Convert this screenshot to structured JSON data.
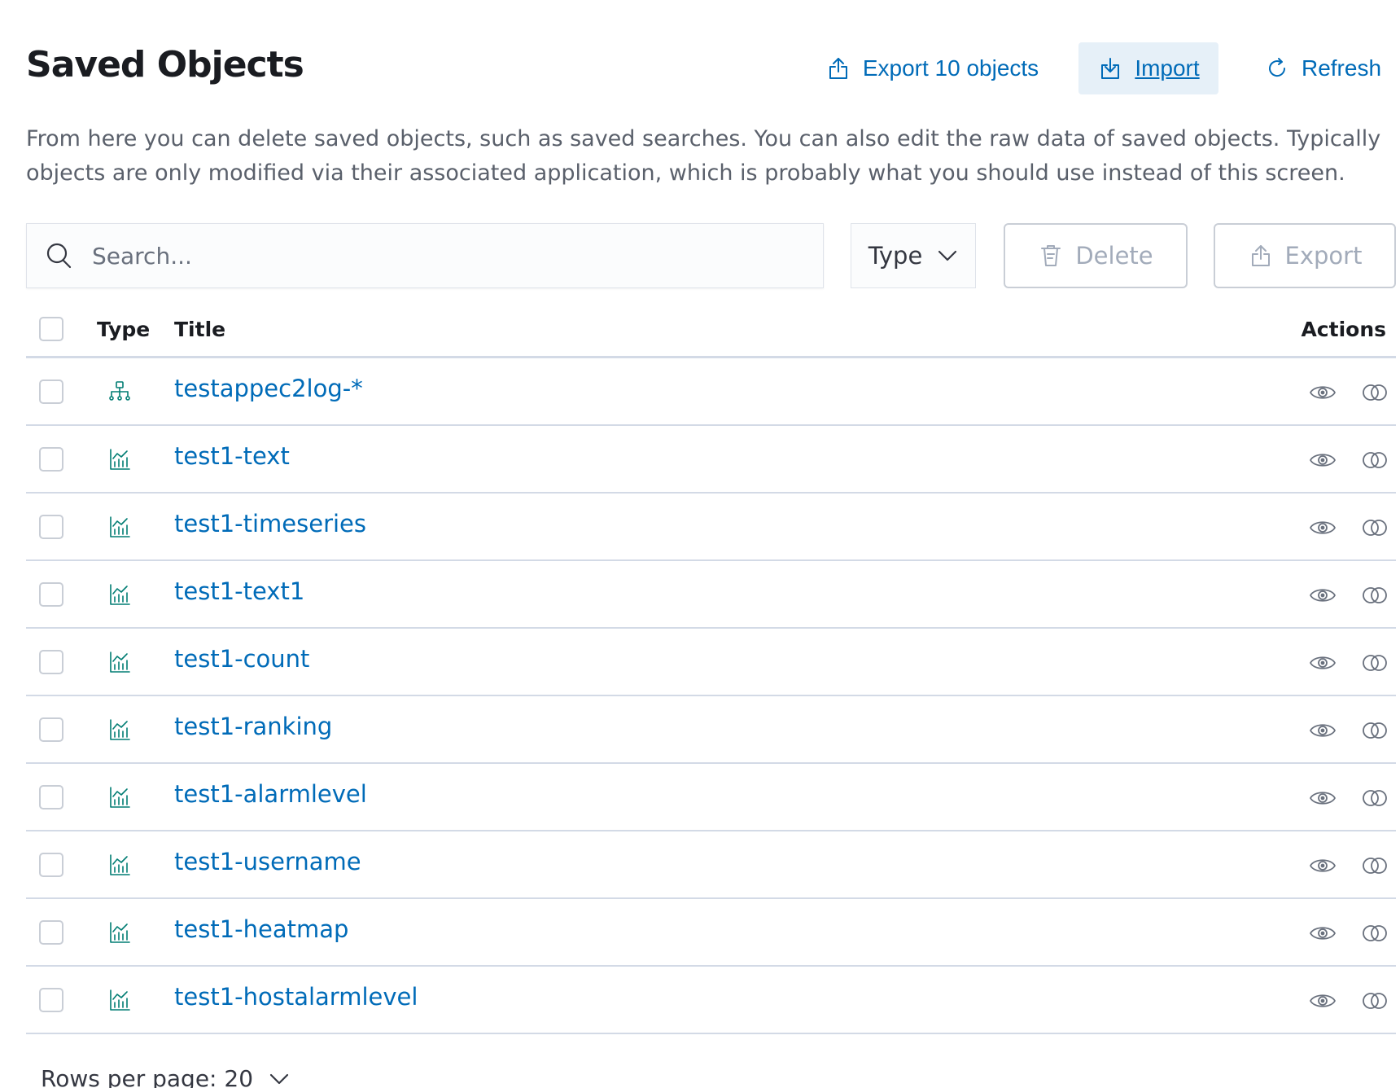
{
  "header": {
    "title": "Saved Objects",
    "export_all_label": "Export 10 objects",
    "import_label": "Import",
    "refresh_label": "Refresh"
  },
  "description": "From here you can delete saved objects, such as saved searches. You can also edit the raw data of saved objects. Typically objects are only modified via their associated application, which is probably what you should use instead of this screen.",
  "toolbar": {
    "search_placeholder": "Search...",
    "type_filter_label": "Type",
    "delete_label": "Delete",
    "export_label": "Export"
  },
  "table": {
    "columns": {
      "type": "Type",
      "title": "Title",
      "actions": "Actions"
    },
    "rows": [
      {
        "type_icon": "index-pattern-icon",
        "title": "testappec2log-*"
      },
      {
        "type_icon": "visualization-icon",
        "title": "test1-text"
      },
      {
        "type_icon": "visualization-icon",
        "title": "test1-timeseries"
      },
      {
        "type_icon": "visualization-icon",
        "title": "test1-text1"
      },
      {
        "type_icon": "visualization-icon",
        "title": "test1-count"
      },
      {
        "type_icon": "visualization-icon",
        "title": "test1-ranking"
      },
      {
        "type_icon": "visualization-icon",
        "title": "test1-alarmlevel"
      },
      {
        "type_icon": "visualization-icon",
        "title": "test1-username"
      },
      {
        "type_icon": "visualization-icon",
        "title": "test1-heatmap"
      },
      {
        "type_icon": "visualization-icon",
        "title": "test1-hostalarmlevel"
      }
    ],
    "row_action_icons": [
      "eye-icon",
      "relationships-icon"
    ]
  },
  "pagination": {
    "rows_per_page_label": "Rows per page: 20"
  },
  "colors": {
    "accent": "#006bb8",
    "import_bg": "#e6f0f8",
    "icon_green": "#017d73",
    "disabled": "#a2abba",
    "border": "#d3dae6"
  }
}
